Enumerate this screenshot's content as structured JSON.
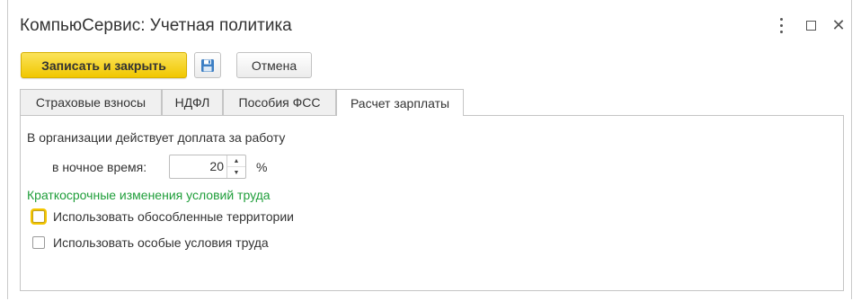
{
  "window": {
    "title": "КомпьюСервис: Учетная политика",
    "more_icon": "more-vertical-icon",
    "maximize_icon": "maximize-icon",
    "close_icon": "close-icon",
    "close_glyph": "✕"
  },
  "toolbar": {
    "save_close_label": "Записать и закрыть",
    "save_icon": "floppy-disk-icon",
    "cancel_label": "Отмена"
  },
  "tabs": [
    {
      "label": "Страховые взносы",
      "active": false
    },
    {
      "label": "НДФЛ",
      "active": false
    },
    {
      "label": "Пособия ФСС",
      "active": false
    },
    {
      "label": "Расчет зарплаты",
      "active": true
    }
  ],
  "payroll": {
    "allowance_heading": "В организации действует доплата за работу",
    "night_label": "в ночное время:",
    "night_value": "20",
    "percent_unit": "%",
    "short_term_heading": "Краткосрочные изменения условий труда",
    "checkbox_territories": {
      "label": "Использовать обособленные территории",
      "checked": false
    },
    "checkbox_special_conditions": {
      "label": "Использовать особые условия труда",
      "checked": false
    }
  },
  "colors": {
    "primary_button": "#f1c700",
    "section_heading": "#1f9e3a",
    "focus_ring": "#f4c600"
  }
}
